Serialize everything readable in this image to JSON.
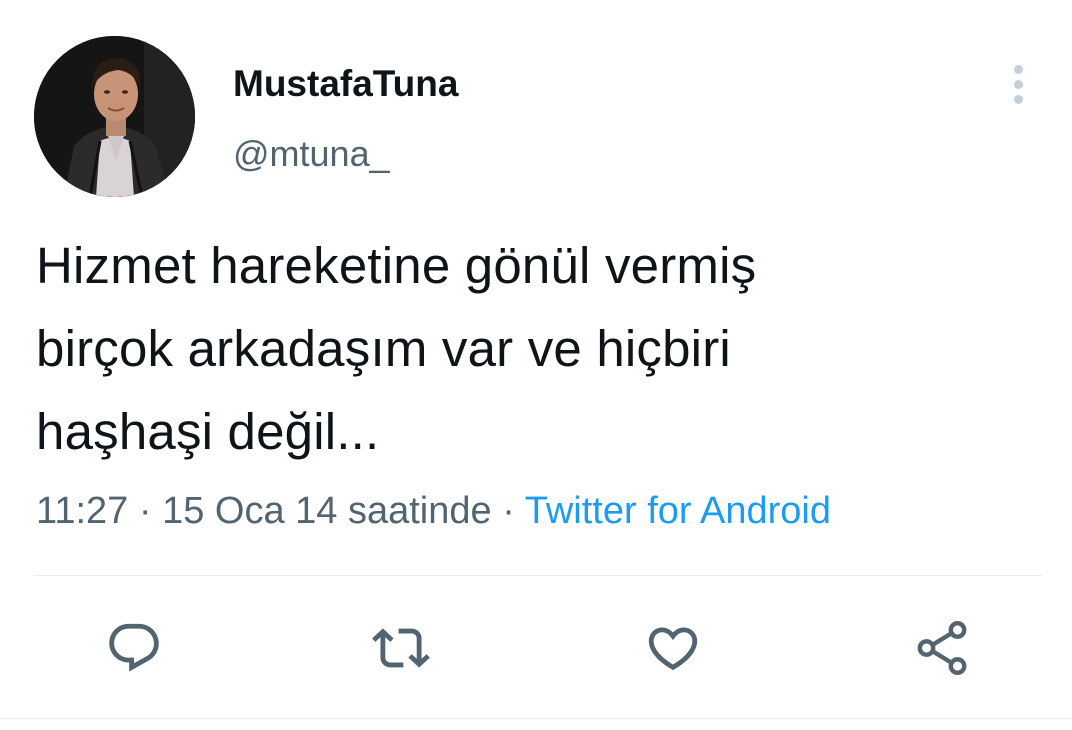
{
  "user": {
    "display_name": "MustafaTuna",
    "handle": "@mtuna_",
    "avatar_icon": "profile-photo"
  },
  "tweet": {
    "lines": [
      "Hizmet hareketine gönül vermiş",
      "birçok arkadaşım var ve hiçbiri",
      "haşhaşi değil..."
    ]
  },
  "meta": {
    "time": "11:27",
    "separator": " · ",
    "date": "15 Oca 14 saatinde",
    "source": "Twitter for Android"
  },
  "actions": [
    {
      "name": "reply",
      "icon": "reply-icon"
    },
    {
      "name": "retweet",
      "icon": "retweet-icon"
    },
    {
      "name": "like",
      "icon": "heart-icon"
    },
    {
      "name": "share",
      "icon": "share-icon"
    }
  ],
  "colors": {
    "text": "#0f1419",
    "secondary": "#536471",
    "accent": "#1d9bf0",
    "icon": "#536471"
  }
}
